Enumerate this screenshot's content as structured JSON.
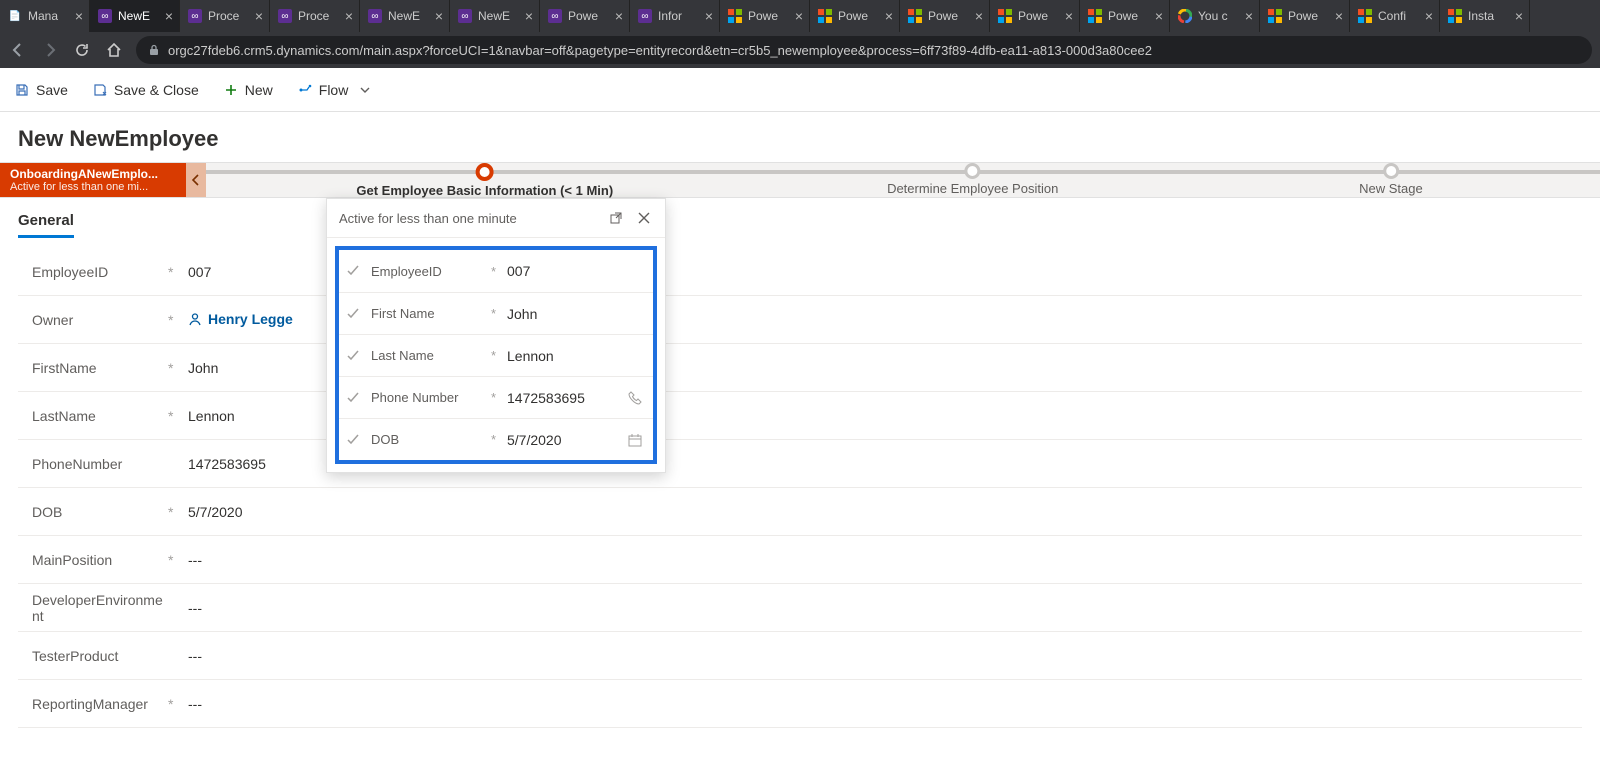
{
  "browser": {
    "active_tab_index": 1,
    "tabs": [
      {
        "title": "Mana",
        "fav": "generic"
      },
      {
        "title": "NewE",
        "fav": "purple"
      },
      {
        "title": "Proce",
        "fav": "purple"
      },
      {
        "title": "Proce",
        "fav": "purple"
      },
      {
        "title": "NewE",
        "fav": "purple"
      },
      {
        "title": "NewE",
        "fav": "purple"
      },
      {
        "title": "Powe",
        "fav": "purple"
      },
      {
        "title": "Infor",
        "fav": "purple"
      },
      {
        "title": "Powe",
        "fav": "ms"
      },
      {
        "title": "Powe",
        "fav": "ms"
      },
      {
        "title": "Powe",
        "fav": "ms"
      },
      {
        "title": "Powe",
        "fav": "ms"
      },
      {
        "title": "Powe",
        "fav": "ms"
      },
      {
        "title": "You c",
        "fav": "google"
      },
      {
        "title": "Powe",
        "fav": "ms"
      },
      {
        "title": "Confi",
        "fav": "ms"
      },
      {
        "title": "Insta",
        "fav": "ms"
      }
    ],
    "url": "orgc27fdeb6.crm5.dynamics.com/main.aspx?forceUCI=1&navbar=off&pagetype=entityrecord&etn=cr5b5_newemployee&process=6ff73f89-4dfb-ea11-a813-000d3a80cee2"
  },
  "commands": {
    "save": "Save",
    "save_close": "Save & Close",
    "new": "New",
    "flow": "Flow"
  },
  "page_title": "New NewEmployee",
  "bpf": {
    "name": "OnboardingANewEmplo...",
    "status": "Active for less than one mi...",
    "stages": [
      {
        "label": "Get Employee Basic Information  (< 1 Min)",
        "active": true
      },
      {
        "label": "Determine Employee Position",
        "active": false
      },
      {
        "label": "New Stage",
        "active": false
      }
    ],
    "flyout": {
      "status": "Active for less than one minute",
      "fields": [
        {
          "label": "EmployeeID",
          "value": "007",
          "req": true,
          "icon": ""
        },
        {
          "label": "First Name",
          "value": "John",
          "req": true,
          "icon": ""
        },
        {
          "label": "Last Name",
          "value": "Lennon",
          "req": true,
          "icon": ""
        },
        {
          "label": "Phone Number",
          "value": "1472583695",
          "req": true,
          "icon": "phone"
        },
        {
          "label": "DOB",
          "value": "5/7/2020",
          "req": true,
          "icon": "calendar"
        }
      ]
    }
  },
  "form": {
    "tab": "General",
    "fields": [
      {
        "label": "EmployeeID",
        "req": true,
        "value": "007",
        "type": "text"
      },
      {
        "label": "Owner",
        "req": true,
        "value": "Henry Legge",
        "type": "lookup"
      },
      {
        "label": "FirstName",
        "req": true,
        "value": "John",
        "type": "text"
      },
      {
        "label": "LastName",
        "req": true,
        "value": "Lennon",
        "type": "text"
      },
      {
        "label": "PhoneNumber",
        "req": false,
        "value": "1472583695",
        "type": "text"
      },
      {
        "label": "DOB",
        "req": true,
        "value": "5/7/2020",
        "type": "text"
      },
      {
        "label": "MainPosition",
        "req": true,
        "value": "---",
        "type": "text"
      },
      {
        "label": "DeveloperEnvironment",
        "req": false,
        "value": "---",
        "type": "text"
      },
      {
        "label": "TesterProduct",
        "req": false,
        "value": "---",
        "type": "text"
      },
      {
        "label": "ReportingManager",
        "req": true,
        "value": "---",
        "type": "text"
      }
    ]
  }
}
